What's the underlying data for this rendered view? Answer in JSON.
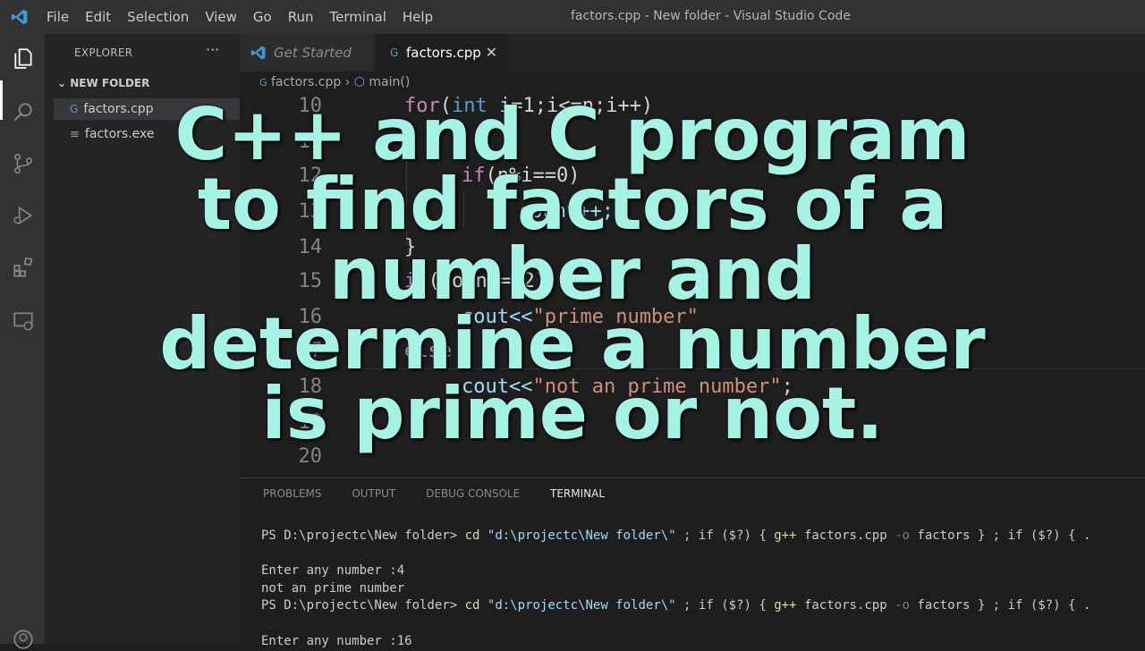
{
  "titlebar": {
    "menu": [
      "File",
      "Edit",
      "Selection",
      "View",
      "Go",
      "Run",
      "Terminal",
      "Help"
    ],
    "window_title": "factors.cpp - New folder - Visual Studio Code"
  },
  "explorer": {
    "title": "EXPLORER",
    "more": "···",
    "folder": "NEW FOLDER",
    "files": [
      {
        "name": "factors.cpp"
      },
      {
        "name": "factors.exe"
      }
    ]
  },
  "tabs": [
    {
      "label": "Get Started"
    },
    {
      "label": "factors.cpp"
    }
  ],
  "breadcrumb": {
    "file": "factors.cpp",
    "symbol": "main()"
  },
  "editor": {
    "line_numbers": [
      "10",
      "11",
      "12",
      "13",
      "14",
      "15",
      "16",
      "17",
      "18",
      "19",
      "20"
    ],
    "code": {
      "for_kw": "for",
      "for_rest_a": "(",
      "for_int": "int",
      "for_rest_b": " i=1;i<=n;i++)",
      "brace_open": "{",
      "if_kw": "if",
      "if_rest": "(n%i==0)",
      "count_inc": "count++;",
      "brace_close": "}",
      "if2_kw": "if",
      "if2_rest": "(count==2)",
      "cout1": "cout<<",
      "str1": "\"prime number\"",
      "else_kw": "else",
      "cout2": "cout<<",
      "str2": "\"not an prime number\"",
      "semi": ";"
    }
  },
  "panel": {
    "tabs": [
      "PROBLEMS",
      "OUTPUT",
      "DEBUG CONSOLE",
      "TERMINAL"
    ],
    "terminal": {
      "prompt": "PS D:\\projectc\\New folder>",
      "cd": "cd",
      "path": "\"d:\\projectc\\New folder\\\"",
      "if_part": "; if ($?) {",
      "gpp": "g++",
      "compile": "factors.cpp",
      "flag": "-o",
      "out": "factors } ; if ($?) { .",
      "enter4": "Enter any number :4",
      "result": "not an prime number",
      "enter16": "Enter any number :16"
    }
  },
  "overlay": {
    "lines": [
      "C++ and C program",
      "to find factors of a",
      "number and",
      "determine a number",
      "is prime or not."
    ]
  },
  "colors": {
    "overlay_text": "#a5f3e4",
    "vscode_blue": "#3c99d4"
  }
}
